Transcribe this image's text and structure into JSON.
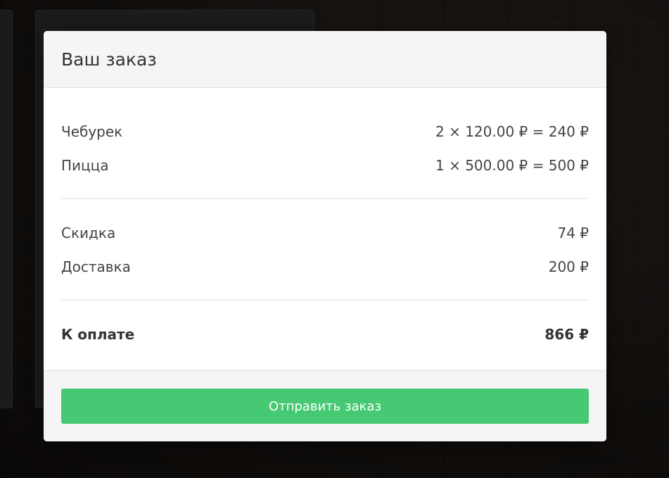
{
  "modal": {
    "title": "Ваш заказ",
    "items": [
      {
        "name": "Чебурек",
        "calc": "2 × 120.00 ₽ = 240 ₽"
      },
      {
        "name": "Пицца",
        "calc": "1 × 500.00 ₽ = 500 ₽"
      }
    ],
    "discount": {
      "label": "Скидка",
      "value": "74 ₽"
    },
    "delivery": {
      "label": "Доставка",
      "value": "200 ₽"
    },
    "total": {
      "label": "К оплате",
      "value": "866 ₽"
    },
    "submit_label": "Отправить заказ"
  },
  "colors": {
    "accent": "#46c973",
    "header_bg": "#f5f5f5"
  }
}
